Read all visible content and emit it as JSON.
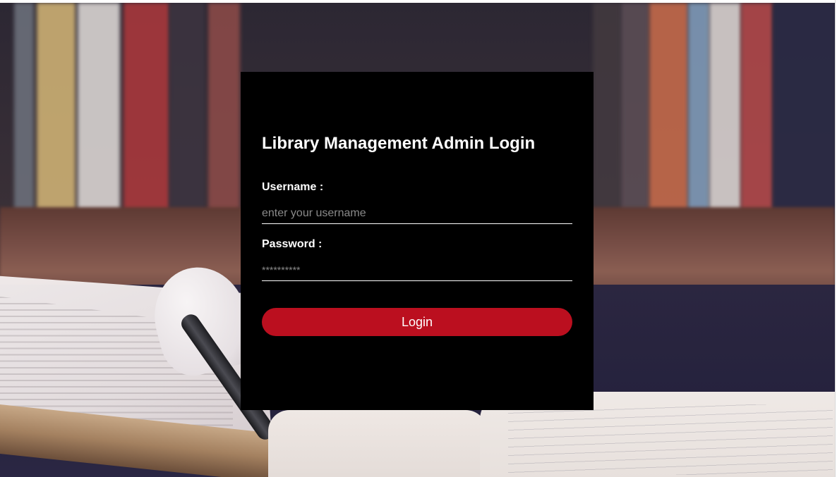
{
  "login": {
    "title": "Library Management Admin Login",
    "username_label": "Username :",
    "username_placeholder": "enter your username",
    "password_label": "Password :",
    "password_placeholder": "**********",
    "submit_label": "Login"
  },
  "colors": {
    "card_background": "#000000",
    "button_background": "#bb0f1f",
    "text": "#ffffff",
    "placeholder": "#8a8a8a"
  }
}
